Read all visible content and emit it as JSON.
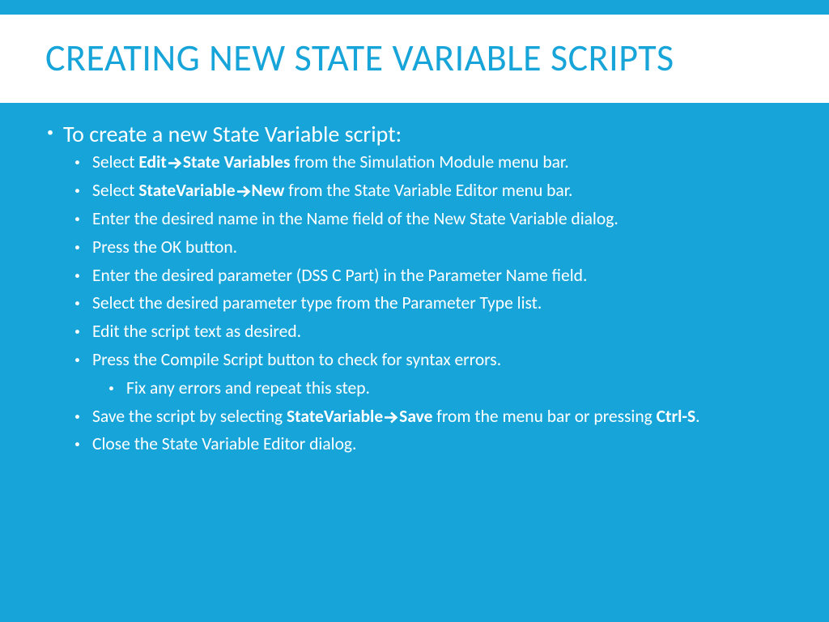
{
  "title": "CREATING NEW STATE VARIABLE SCRIPTS",
  "intro": "To create a new State Variable script:",
  "steps": [
    {
      "segments": [
        {
          "t": "Select ",
          "b": false
        },
        {
          "t": "Edit",
          "b": true
        },
        {
          "arrow": true,
          "b": true
        },
        {
          "t": "State Variables",
          "b": true
        },
        {
          "t": " from the Simulation Module menu bar.",
          "b": false
        }
      ]
    },
    {
      "segments": [
        {
          "t": "Select ",
          "b": false
        },
        {
          "t": "StateVariable",
          "b": true
        },
        {
          "arrow": true,
          "b": true
        },
        {
          "t": "New",
          "b": true
        },
        {
          "t": " from the State Variable Editor menu bar.",
          "b": false
        }
      ]
    },
    {
      "segments": [
        {
          "t": "Enter the desired name in the Name field of the New State Variable dialog.",
          "b": false
        }
      ]
    },
    {
      "segments": [
        {
          "t": "Press the OK button.",
          "b": false
        }
      ]
    },
    {
      "segments": [
        {
          "t": "Enter the desired parameter (DSS C Part) in the Parameter Name field.",
          "b": false
        }
      ]
    },
    {
      "segments": [
        {
          "t": "Select the desired parameter type from the Parameter Type list.",
          "b": false
        }
      ]
    },
    {
      "segments": [
        {
          "t": "Edit the script text as desired.",
          "b": false
        }
      ]
    },
    {
      "segments": [
        {
          "t": "Press the Compile Script button to check for syntax errors.",
          "b": false
        }
      ],
      "sub": [
        {
          "segments": [
            {
              "t": "Fix any errors and repeat this step.",
              "b": false
            }
          ]
        }
      ]
    },
    {
      "segments": [
        {
          "t": "Save the script by selecting ",
          "b": false
        },
        {
          "t": "StateVariable",
          "b": true
        },
        {
          "arrow": true,
          "b": true
        },
        {
          "t": "Save",
          "b": true
        },
        {
          "t": " from the menu bar or pressing ",
          "b": false
        },
        {
          "t": "Ctrl-S",
          "b": true
        },
        {
          "t": ".",
          "b": false
        }
      ]
    },
    {
      "segments": [
        {
          "t": "Close the State Variable Editor dialog.",
          "b": false
        }
      ]
    }
  ]
}
